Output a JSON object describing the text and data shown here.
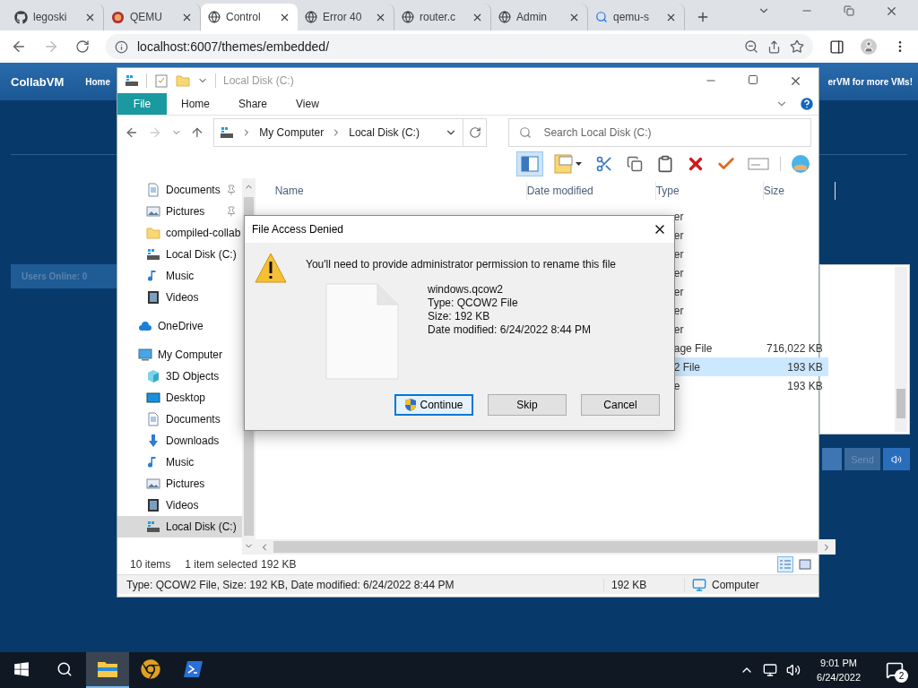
{
  "browser": {
    "tabs": [
      {
        "title": "legoski",
        "selected": false,
        "kind": "github"
      },
      {
        "title": "QEMU",
        "selected": false,
        "kind": "qemu"
      },
      {
        "title": "Control",
        "selected": true,
        "kind": "globe"
      },
      {
        "title": "Error 40",
        "selected": false,
        "kind": "globe"
      },
      {
        "title": "router.c",
        "selected": false,
        "kind": "globe"
      },
      {
        "title": "Admin",
        "selected": false,
        "kind": "globe"
      },
      {
        "title": "qemu-s",
        "selected": false,
        "kind": "search"
      }
    ],
    "address": "localhost:6007/themes/embedded/"
  },
  "page": {
    "brand": "CollabVM",
    "nav_items": [
      "Home"
    ],
    "banner": "erVM for more VMs!",
    "users_online": "Users Online: 0",
    "send_button": {
      "label": "Send",
      "disabled": true
    }
  },
  "explorer": {
    "title": "Local Disk (C:)",
    "ribbon_tabs": [
      {
        "label": "File",
        "selected": true
      },
      {
        "label": "Home",
        "selected": false
      },
      {
        "label": "Share",
        "selected": false
      },
      {
        "label": "View",
        "selected": false
      }
    ],
    "breadcrumb": [
      "My Computer",
      "Local Disk (C:)"
    ],
    "search_placeholder": "Search Local Disk (C:)",
    "quick_access": [
      {
        "label": "Documents",
        "kind": "documents",
        "pinned": true,
        "selected": false
      },
      {
        "label": "Pictures",
        "kind": "pictures",
        "pinned": true,
        "selected": false
      },
      {
        "label": "compiled-collab",
        "kind": "folder",
        "pinned": false,
        "selected": false
      },
      {
        "label": "Local Disk (C:)",
        "kind": "disk",
        "pinned": false,
        "selected": false
      },
      {
        "label": "Music",
        "kind": "music",
        "pinned": false,
        "selected": false
      },
      {
        "label": "Videos",
        "kind": "videos",
        "pinned": false,
        "selected": false
      }
    ],
    "nav_items": [
      {
        "label": "OneDrive",
        "kind": "cloud",
        "selected": false
      },
      {
        "label": "My Computer",
        "kind": "computer",
        "selected": false,
        "children": [
          {
            "label": "3D Objects",
            "kind": "cube",
            "selected": false
          },
          {
            "label": "Desktop",
            "kind": "desktop",
            "selected": false
          },
          {
            "label": "Documents",
            "kind": "documents",
            "selected": false
          },
          {
            "label": "Downloads",
            "kind": "downloads",
            "selected": false
          },
          {
            "label": "Music",
            "kind": "music",
            "selected": false
          },
          {
            "label": "Pictures",
            "kind": "pictures",
            "selected": false
          },
          {
            "label": "Videos",
            "kind": "videos",
            "selected": false
          },
          {
            "label": "Local Disk (C:)",
            "kind": "disk",
            "selected": true
          }
        ]
      }
    ],
    "columns": [
      "Name",
      "Date modified",
      "Type",
      "Size"
    ],
    "rows": [
      {
        "type": "er",
        "selected": false
      },
      {
        "type": "er",
        "selected": false
      },
      {
        "type": "er",
        "selected": false
      },
      {
        "type": "er",
        "selected": false
      },
      {
        "type": "er",
        "selected": false
      },
      {
        "type": "er",
        "selected": false
      },
      {
        "type": "er",
        "selected": false
      },
      {
        "type": "age File",
        "size": "716,022 KB",
        "selected": false
      },
      {
        "type": "2 File",
        "size": "193 KB",
        "selected": true
      },
      {
        "type": "e",
        "size": "193 KB",
        "selected": false
      }
    ],
    "status": {
      "item_count": "10 items",
      "selection": "1 item selected",
      "selection_size": "192 KB"
    },
    "status_bar": {
      "details": "Type: QCOW2 File, Size: 192 KB, Date modified: 6/24/2022 8:44 PM",
      "size": "192 KB",
      "location": "Computer"
    }
  },
  "dialog": {
    "title": "File Access Denied",
    "message": "You'll need to provide administrator permission to rename this file",
    "details": [
      "windows.qcow2",
      "Type: QCOW2 File",
      "Size: 192 KB",
      "Date modified: 6/24/2022 8:44 PM"
    ],
    "buttons": [
      {
        "label": "Continue",
        "kind": "shield",
        "default": true
      },
      {
        "label": "Skip",
        "kind": "plain",
        "default": false
      },
      {
        "label": "Cancel",
        "kind": "plain",
        "default": false
      }
    ]
  },
  "taskbar": {
    "apps": [
      {
        "kind": "explorer",
        "active": true
      },
      {
        "kind": "chrome",
        "active": false
      },
      {
        "kind": "powershell",
        "active": false
      }
    ],
    "time": "9:01 PM",
    "date": "6/24/2022",
    "notifications": "2"
  }
}
